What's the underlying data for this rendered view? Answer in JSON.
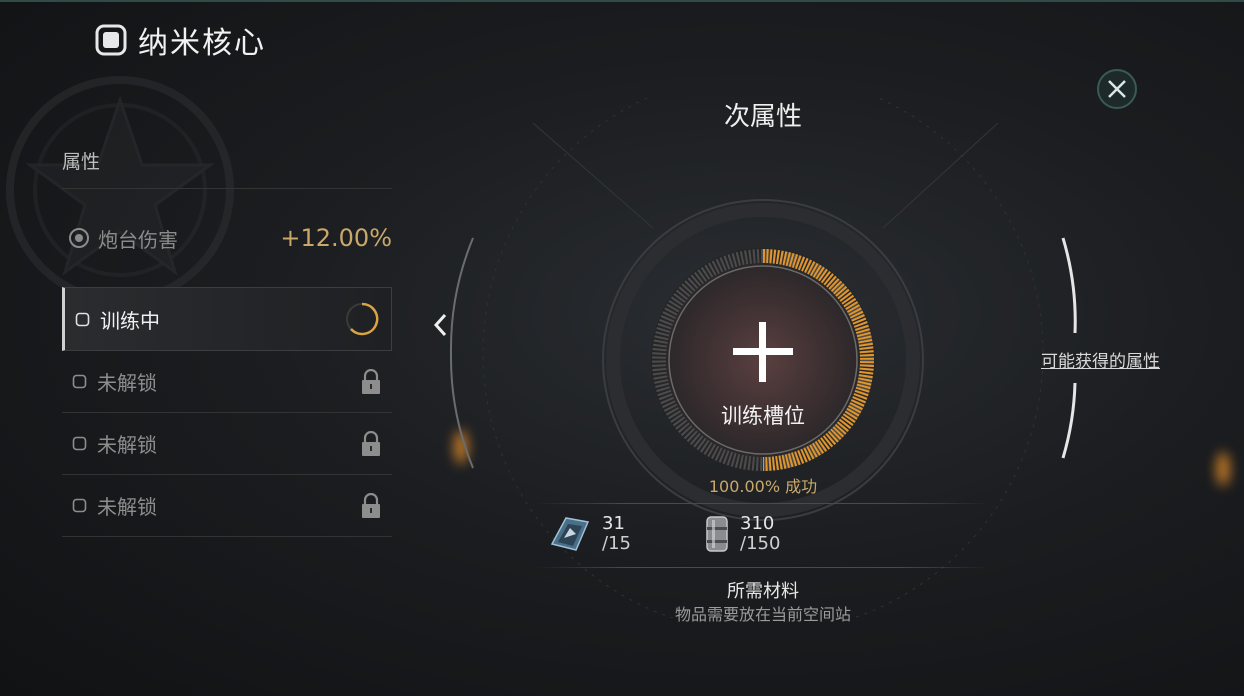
{
  "header": {
    "title": "纳米核心",
    "icon": "chip-icon"
  },
  "panel": {
    "section_title": "属性",
    "attribute": {
      "label": "炮台伤害",
      "value": "+12.00%",
      "icon": "target-icon"
    },
    "slots": [
      {
        "label": "训练中",
        "status": "training",
        "progress": 0.7
      },
      {
        "label": "未解锁",
        "status": "locked"
      },
      {
        "label": "未解锁",
        "status": "locked"
      },
      {
        "label": "未解锁",
        "status": "locked"
      }
    ]
  },
  "center": {
    "title": "次属性",
    "slot_label": "训练槽位",
    "success_rate": "100.00% 成功",
    "ring_progress": 0.5
  },
  "side_link": "可能获得的属性",
  "materials": [
    {
      "icon": "chip-module-icon",
      "have": "31",
      "need": "/15"
    },
    {
      "icon": "canister-icon",
      "have": "310",
      "need": "/150"
    }
  ],
  "requirements": {
    "title": "所需材料",
    "note": "物品需要放在当前空间站"
  },
  "colors": {
    "accent": "#c9a86a",
    "orange": "#e89a2a",
    "background": "#1b1d20"
  }
}
